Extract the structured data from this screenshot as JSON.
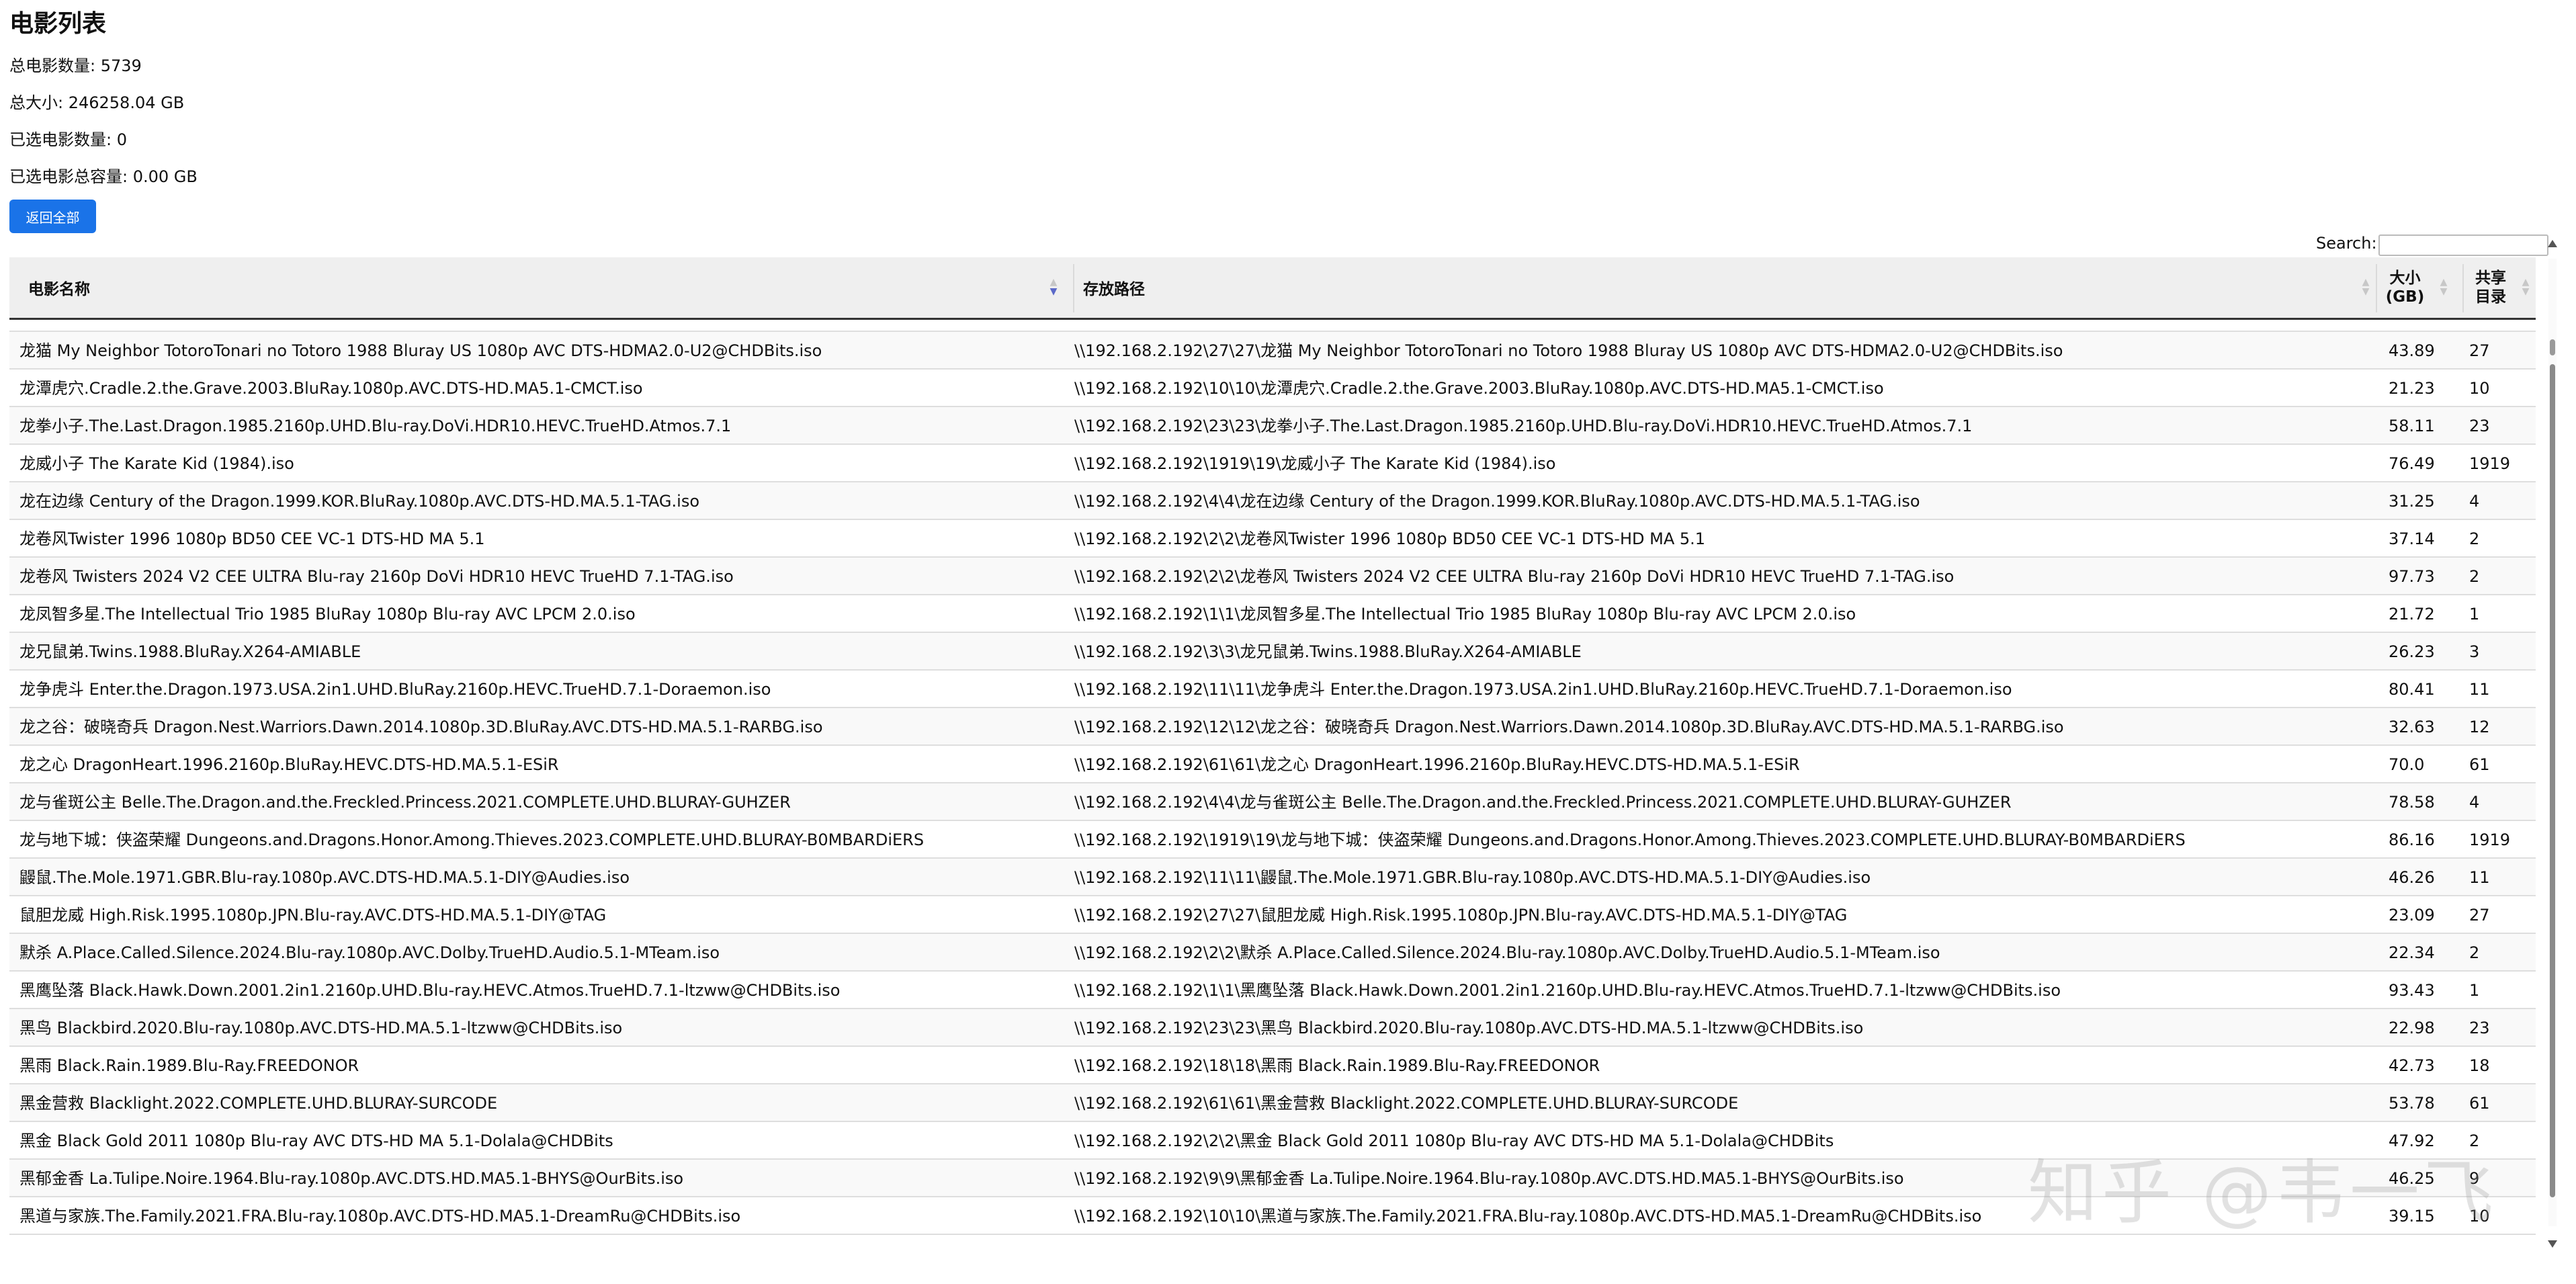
{
  "page": {
    "title": "电影列表",
    "total_count_text": "总电影数量: 5739",
    "total_size_text": "总大小: 246258.04 GB",
    "selected_count_text": "已选电影数量: 0",
    "selected_size_text": "已选电影总容量: 0.00 GB",
    "reset_button": "返回全部"
  },
  "search": {
    "label": "Search:",
    "value": ""
  },
  "table": {
    "headers": {
      "name": "电影名称",
      "path": "存放路径",
      "size_line1": "大小",
      "size_line2": "(GB)",
      "share_line1": "共享",
      "share_line2": "目录"
    },
    "rows": [
      {
        "name": "龙猫 My Neighbor TotoroTonari no Totoro 1988 Bluray US 1080p AVC DTS-HDMA2.0-U2@CHDBits.iso",
        "path": "\\\\192.168.2.192\\27\\27\\龙猫 My Neighbor TotoroTonari no Totoro 1988 Bluray US 1080p AVC DTS-HDMA2.0-U2@CHDBits.iso",
        "size": "43.89",
        "share": "27"
      },
      {
        "name": "龙潭虎穴.Cradle.2.the.Grave.2003.BluRay.1080p.AVC.DTS-HD.MA5.1-CMCT.iso",
        "path": "\\\\192.168.2.192\\10\\10\\龙潭虎穴.Cradle.2.the.Grave.2003.BluRay.1080p.AVC.DTS-HD.MA5.1-CMCT.iso",
        "size": "21.23",
        "share": "10"
      },
      {
        "name": "龙拳小子.The.Last.Dragon.1985.2160p.UHD.Blu-ray.DoVi.HDR10.HEVC.TrueHD.Atmos.7.1",
        "path": "\\\\192.168.2.192\\23\\23\\龙拳小子.The.Last.Dragon.1985.2160p.UHD.Blu-ray.DoVi.HDR10.HEVC.TrueHD.Atmos.7.1",
        "size": "58.11",
        "share": "23"
      },
      {
        "name": "龙威小子 The Karate Kid (1984).iso",
        "path": "\\\\192.168.2.192\\1919\\19\\龙威小子 The Karate Kid (1984).iso",
        "size": "76.49",
        "share": "1919"
      },
      {
        "name": "龙在边缘 Century of the Dragon.1999.KOR.BluRay.1080p.AVC.DTS-HD.MA.5.1-TAG.iso",
        "path": "\\\\192.168.2.192\\4\\4\\龙在边缘 Century of the Dragon.1999.KOR.BluRay.1080p.AVC.DTS-HD.MA.5.1-TAG.iso",
        "size": "31.25",
        "share": "4"
      },
      {
        "name": "龙卷风Twister 1996 1080p BD50 CEE VC-1 DTS-HD MA 5.1",
        "path": "\\\\192.168.2.192\\2\\2\\龙卷风Twister 1996 1080p BD50 CEE VC-1 DTS-HD MA 5.1",
        "size": "37.14",
        "share": "2"
      },
      {
        "name": "龙卷风 Twisters 2024 V2 CEE ULTRA Blu-ray 2160p DoVi HDR10 HEVC TrueHD 7.1-TAG.iso",
        "path": "\\\\192.168.2.192\\2\\2\\龙卷风 Twisters 2024 V2 CEE ULTRA Blu-ray 2160p DoVi HDR10 HEVC TrueHD 7.1-TAG.iso",
        "size": "97.73",
        "share": "2"
      },
      {
        "name": "龙凤智多星.The Intellectual Trio 1985 BluRay 1080p Blu-ray AVC LPCM 2.0.iso",
        "path": "\\\\192.168.2.192\\1\\1\\龙凤智多星.The Intellectual Trio 1985 BluRay 1080p Blu-ray AVC LPCM 2.0.iso",
        "size": "21.72",
        "share": "1"
      },
      {
        "name": "龙兄鼠弟.Twins.1988.BluRay.X264-AMIABLE",
        "path": "\\\\192.168.2.192\\3\\3\\龙兄鼠弟.Twins.1988.BluRay.X264-AMIABLE",
        "size": "26.23",
        "share": "3"
      },
      {
        "name": "龙争虎斗 Enter.the.Dragon.1973.USA.2in1.UHD.BluRay.2160p.HEVC.TrueHD.7.1-Doraemon.iso",
        "path": "\\\\192.168.2.192\\11\\11\\龙争虎斗 Enter.the.Dragon.1973.USA.2in1.UHD.BluRay.2160p.HEVC.TrueHD.7.1-Doraemon.iso",
        "size": "80.41",
        "share": "11"
      },
      {
        "name": "龙之谷：破晓奇兵 Dragon.Nest.Warriors.Dawn.2014.1080p.3D.BluRay.AVC.DTS-HD.MA.5.1-RARBG.iso",
        "path": "\\\\192.168.2.192\\12\\12\\龙之谷：破晓奇兵 Dragon.Nest.Warriors.Dawn.2014.1080p.3D.BluRay.AVC.DTS-HD.MA.5.1-RARBG.iso",
        "size": "32.63",
        "share": "12"
      },
      {
        "name": "龙之心 DragonHeart.1996.2160p.BluRay.HEVC.DTS-HD.MA.5.1-ESiR",
        "path": "\\\\192.168.2.192\\61\\61\\龙之心 DragonHeart.1996.2160p.BluRay.HEVC.DTS-HD.MA.5.1-ESiR",
        "size": "70.0",
        "share": "61"
      },
      {
        "name": "龙与雀斑公主 Belle.The.Dragon.and.the.Freckled.Princess.2021.COMPLETE.UHD.BLURAY-GUHZER",
        "path": "\\\\192.168.2.192\\4\\4\\龙与雀斑公主 Belle.The.Dragon.and.the.Freckled.Princess.2021.COMPLETE.UHD.BLURAY-GUHZER",
        "size": "78.58",
        "share": "4"
      },
      {
        "name": "龙与地下城：侠盗荣耀 Dungeons.and.Dragons.Honor.Among.Thieves.2023.COMPLETE.UHD.BLURAY-B0MBARDiERS",
        "path": "\\\\192.168.2.192\\1919\\19\\龙与地下城：侠盗荣耀 Dungeons.and.Dragons.Honor.Among.Thieves.2023.COMPLETE.UHD.BLURAY-B0MBARDiERS",
        "size": "86.16",
        "share": "1919"
      },
      {
        "name": "鼹鼠.The.Mole.1971.GBR.Blu-ray.1080p.AVC.DTS-HD.MA.5.1-DIY@Audies.iso",
        "path": "\\\\192.168.2.192\\11\\11\\鼹鼠.The.Mole.1971.GBR.Blu-ray.1080p.AVC.DTS-HD.MA.5.1-DIY@Audies.iso",
        "size": "46.26",
        "share": "11"
      },
      {
        "name": "鼠胆龙威 High.Risk.1995.1080p.JPN.Blu-ray.AVC.DTS-HD.MA.5.1-DIY@TAG",
        "path": "\\\\192.168.2.192\\27\\27\\鼠胆龙威 High.Risk.1995.1080p.JPN.Blu-ray.AVC.DTS-HD.MA.5.1-DIY@TAG",
        "size": "23.09",
        "share": "27"
      },
      {
        "name": "默杀 A.Place.Called.Silence.2024.Blu-ray.1080p.AVC.Dolby.TrueHD.Audio.5.1-MTeam.iso",
        "path": "\\\\192.168.2.192\\2\\2\\默杀 A.Place.Called.Silence.2024.Blu-ray.1080p.AVC.Dolby.TrueHD.Audio.5.1-MTeam.iso",
        "size": "22.34",
        "share": "2"
      },
      {
        "name": "黑鹰坠落 Black.Hawk.Down.2001.2in1.2160p.UHD.Blu-ray.HEVC.Atmos.TrueHD.7.1-ltzww@CHDBits.iso",
        "path": "\\\\192.168.2.192\\1\\1\\黑鹰坠落 Black.Hawk.Down.2001.2in1.2160p.UHD.Blu-ray.HEVC.Atmos.TrueHD.7.1-ltzww@CHDBits.iso",
        "size": "93.43",
        "share": "1"
      },
      {
        "name": "黑鸟 Blackbird.2020.Blu-ray.1080p.AVC.DTS-HD.MA.5.1-ltzww@CHDBits.iso",
        "path": "\\\\192.168.2.192\\23\\23\\黑鸟 Blackbird.2020.Blu-ray.1080p.AVC.DTS-HD.MA.5.1-ltzww@CHDBits.iso",
        "size": "22.98",
        "share": "23"
      },
      {
        "name": "黑雨 Black.Rain.1989.Blu-Ray.FREEDONOR",
        "path": "\\\\192.168.2.192\\18\\18\\黑雨 Black.Rain.1989.Blu-Ray.FREEDONOR",
        "size": "42.73",
        "share": "18"
      },
      {
        "name": "黑金营救 Blacklight.2022.COMPLETE.UHD.BLURAY-SURCODE",
        "path": "\\\\192.168.2.192\\61\\61\\黑金营救 Blacklight.2022.COMPLETE.UHD.BLURAY-SURCODE",
        "size": "53.78",
        "share": "61"
      },
      {
        "name": "黑金 Black Gold 2011 1080p Blu-ray AVC DTS-HD MA 5.1-Dolala@CHDBits",
        "path": "\\\\192.168.2.192\\2\\2\\黑金 Black Gold 2011 1080p Blu-ray AVC DTS-HD MA 5.1-Dolala@CHDBits",
        "size": "47.92",
        "share": "2"
      },
      {
        "name": "黑郁金香 La.Tulipe.Noire.1964.Blu-ray.1080p.AVC.DTS.HD.MA5.1-BHYS@OurBits.iso",
        "path": "\\\\192.168.2.192\\9\\9\\黑郁金香 La.Tulipe.Noire.1964.Blu-ray.1080p.AVC.DTS.HD.MA5.1-BHYS@OurBits.iso",
        "size": "46.25",
        "share": "9"
      },
      {
        "name": "黑道与家族.The.Family.2021.FRA.Blu-ray.1080p.AVC.DTS-HD.MA5.1-DreamRu@CHDBits.iso",
        "path": "\\\\192.168.2.192\\10\\10\\黑道与家族.The.Family.2021.FRA.Blu-ray.1080p.AVC.DTS-HD.MA5.1-DreamRu@CHDBits.iso",
        "size": "39.15",
        "share": "10"
      }
    ]
  },
  "watermark": "知乎 @韦一飞",
  "colors": {
    "accent": "#1a73e8",
    "sort_active": "#5b69c8",
    "header_bg": "#efefef"
  },
  "icons": {
    "sort": "sort-arrows-icon",
    "scroll_up": "scroll-up-arrow-icon",
    "scroll_down": "scroll-down-arrow-icon"
  }
}
